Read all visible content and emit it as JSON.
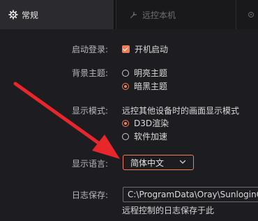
{
  "tabs": [
    {
      "label": "常规",
      "icon": "gear-icon",
      "active": true
    },
    {
      "label": "远控本机",
      "icon": "remote-control-icon",
      "active": false
    },
    {
      "label": "",
      "icon": "circle-icon",
      "active": false
    }
  ],
  "settings": {
    "startup": {
      "label": "启动登录:",
      "option": "开机启动",
      "checked": true
    },
    "theme": {
      "label": "背景主题:",
      "options": [
        "明亮主题",
        "暗黑主题"
      ],
      "selected": "暗黑主题"
    },
    "display_mode": {
      "label": "显示模式:",
      "description": "远控其他设备时的画面显示模式",
      "options": [
        "D3D渲染",
        "软件加速"
      ],
      "selected": "D3D渲染"
    },
    "language": {
      "label": "显示语言:",
      "value": "简体中文"
    },
    "log": {
      "label": "日志保存:",
      "path": "C:\\ProgramData\\Oray\\SunloginC",
      "hint": "远程控制的日志保存于此"
    }
  },
  "colors": {
    "accent": "#f07d55",
    "annotation_arrow": "#e8262b",
    "background": "#1d1d21"
  }
}
